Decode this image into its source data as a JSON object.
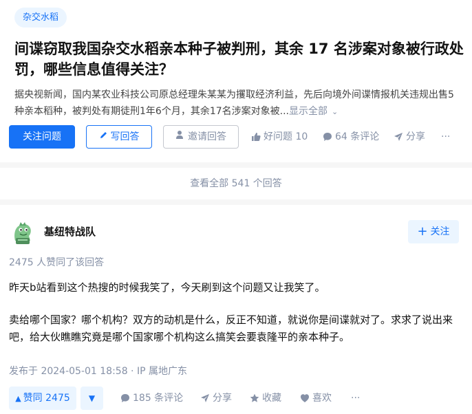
{
  "question": {
    "topic_tag": "杂交水稻",
    "title": "间谍窃取我国杂交水稻亲本种子被判刑，其余 17 名涉案对象被行政处罚，哪些信息值得关注？",
    "summary": "据央视新闻，国内某农业科技公司原总经理朱某某为攫取经济利益，先后向境外间谍情报机关违规出售5种亲本稻种，被判处有期徒刑1年6个月，其余17名涉案对象被...",
    "show_all": "显示全部",
    "actions": {
      "follow_question": "关注问题",
      "write_answer": "写回答",
      "invite_answer": "邀请回答",
      "good_question": "好问题 10",
      "comments": "64 条评论",
      "share": "分享",
      "more": "···"
    }
  },
  "see_all_answers": "查看全部 541 个回答",
  "answer": {
    "author": {
      "name": "基纽特战队",
      "avatar_icon": "green-dinosaur-avatar"
    },
    "follow_label": "关注",
    "upvote_text": "2475 人赞同了该回答",
    "paragraphs": [
      "昨天b站看到这个热搜的时候我笑了，今天刷到这个问题又让我笑了。",
      "卖给哪个国家？哪个机构？双方的动机是什么，反正不知道，就说你是间谍就对了。求求了说出来吧，给大伙瞧瞧究竟是哪个国家哪个机构这么搞笑会要袁隆平的亲本种子。"
    ],
    "published": "发布于 2024-05-01 18:58 · IP 属地广东",
    "actions": {
      "upvote": "赞同 2475",
      "comments": "185 条评论",
      "share": "分享",
      "collect": "收藏",
      "like": "喜欢",
      "more": "···"
    }
  },
  "colors": {
    "accent": "#1772f6",
    "accent_light": "#ebf5ff",
    "muted": "#8590a6",
    "page_bg": "#f6f6f6"
  }
}
